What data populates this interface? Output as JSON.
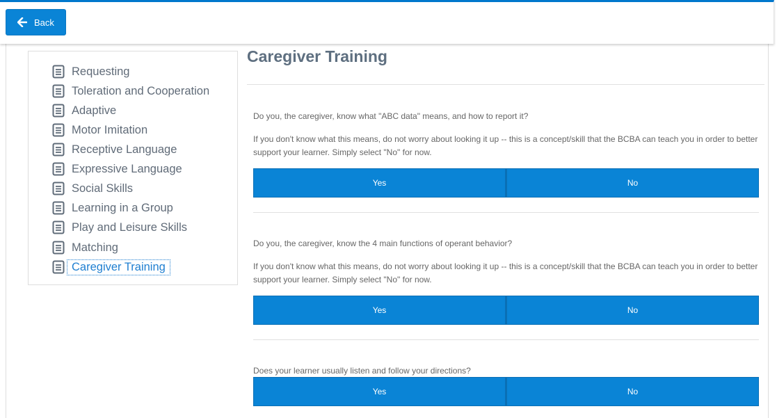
{
  "header": {
    "back_label": "Back"
  },
  "sidebar": {
    "items": [
      {
        "label": "Requesting"
      },
      {
        "label": "Toleration and Cooperation"
      },
      {
        "label": "Adaptive"
      },
      {
        "label": "Motor Imitation"
      },
      {
        "label": "Receptive Language"
      },
      {
        "label": "Expressive Language"
      },
      {
        "label": "Social Skills"
      },
      {
        "label": "Learning in a Group"
      },
      {
        "label": "Play and Leisure Skills"
      },
      {
        "label": "Matching"
      },
      {
        "label": "Caregiver Training"
      }
    ],
    "active_item": "Caregiver Training"
  },
  "main": {
    "title": "Caregiver Training",
    "questions": [
      {
        "text": "Do you, the caregiver, know what \"ABC data\" means, and how to report it?",
        "hint": "If you don't know what this means, do not worry about looking it up -- this is a concept/skill that the BCBA can teach you in order to better support your learner. Simply select \"No\" for now.",
        "yes_label": "Yes",
        "no_label": "No"
      },
      {
        "text": "Do you, the caregiver, know the 4 main functions of operant behavior?",
        "hint": "If you don't know what this means, do not worry about looking it up -- this is a concept/skill that the BCBA can teach you in order to better support your learner. Simply select \"No\" for now.",
        "yes_label": "Yes",
        "no_label": "No"
      },
      {
        "text": "Does your learner usually listen and follow your directions?",
        "yes_label": "Yes",
        "no_label": "No"
      }
    ]
  },
  "colors": {
    "accent": "#0a84d6",
    "top_border": "#0077cc",
    "active_link": "#1f7fd1"
  },
  "icons": {
    "back": "arrow-left-icon",
    "nav_item": "document-icon"
  }
}
